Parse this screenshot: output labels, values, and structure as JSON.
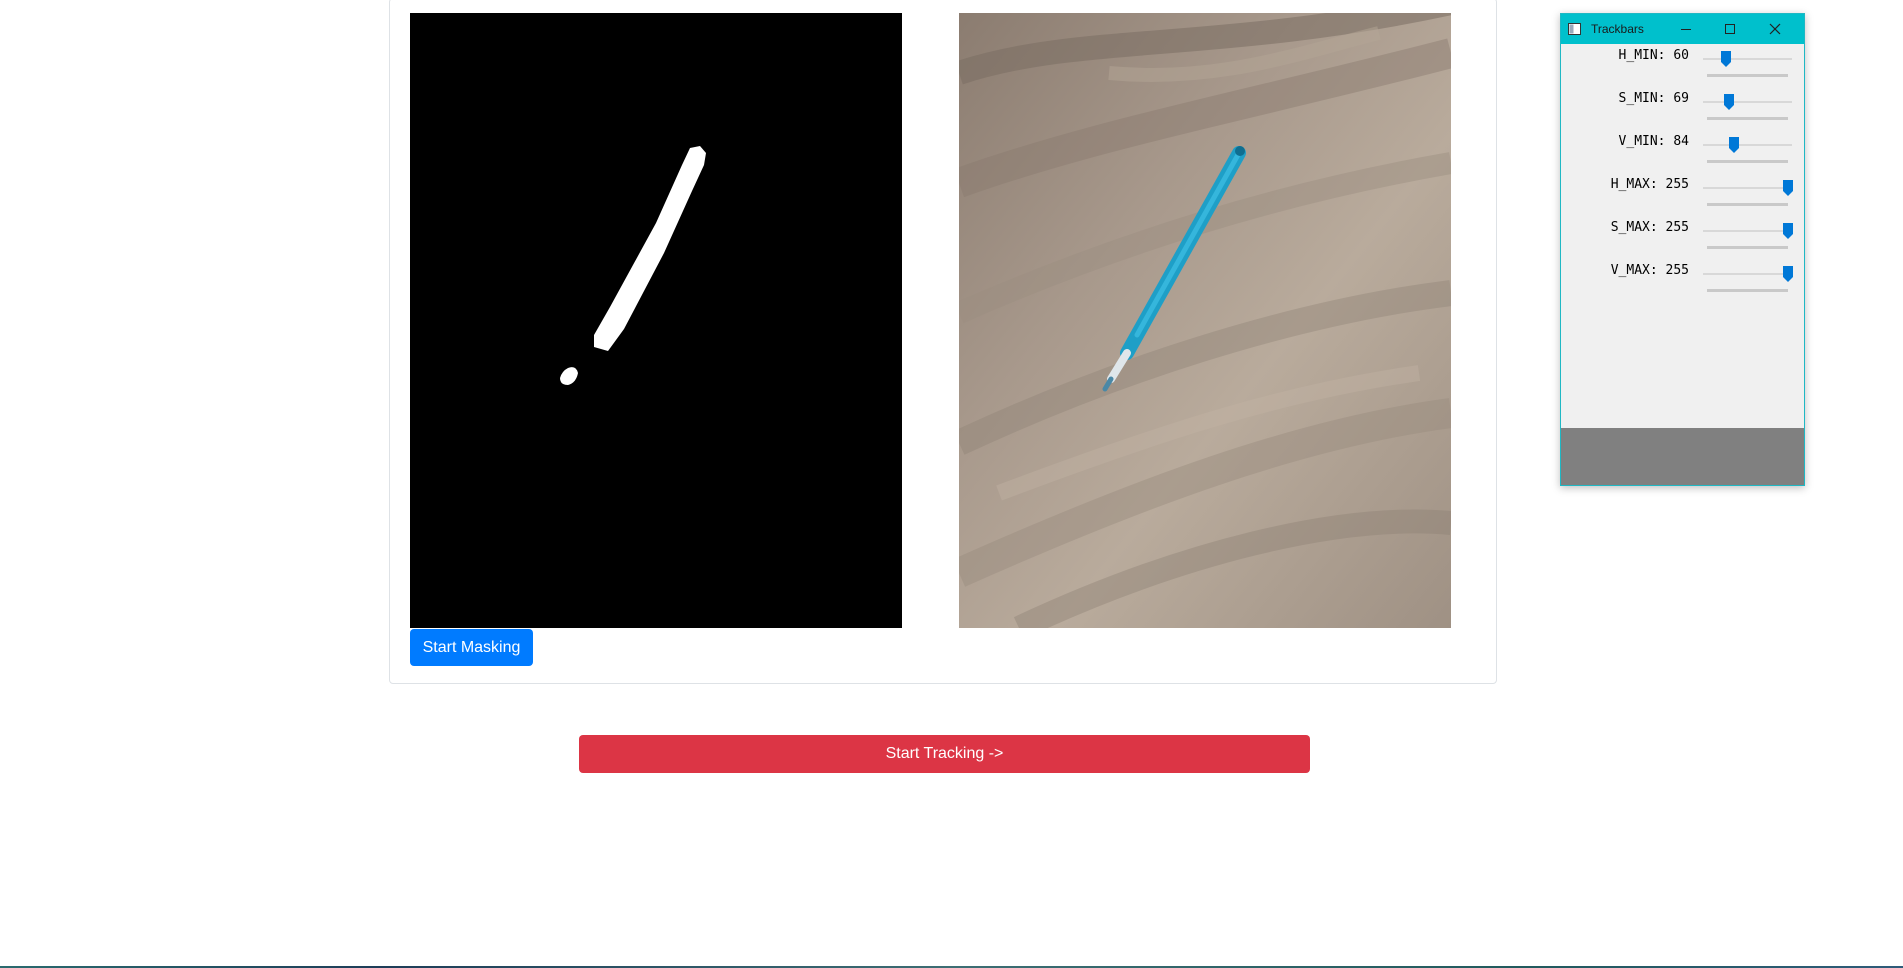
{
  "buttons": {
    "start_masking": "Start Masking",
    "start_tracking": "Start Tracking ->"
  },
  "trackbars_window": {
    "title": "Trackbars",
    "controls": [
      "minimize-icon",
      "maximize-icon",
      "close-icon"
    ],
    "accent_color": "#00c0cc",
    "sliders": [
      {
        "label": "H_MIN: 60",
        "value": 60,
        "max": 255
      },
      {
        "label": "S_MIN: 69",
        "value": 69,
        "max": 255
      },
      {
        "label": "V_MIN: 84",
        "value": 84,
        "max": 255
      },
      {
        "label": "H_MAX: 255",
        "value": 255,
        "max": 255
      },
      {
        "label": "S_MAX: 255",
        "value": 255,
        "max": 255
      },
      {
        "label": "V_MAX: 255",
        "value": 255,
        "max": 255
      }
    ]
  },
  "colors": {
    "primary": "#007bff",
    "danger": "#dc3545",
    "slider_thumb": "#0078d7"
  }
}
